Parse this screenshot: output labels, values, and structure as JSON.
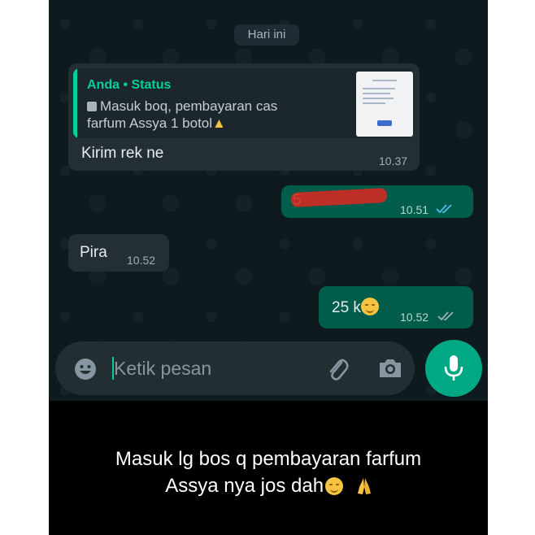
{
  "chat": {
    "date_chip": "Hari ini",
    "messages": [
      {
        "id": "m1",
        "direction": "incoming",
        "quote_author": "Anda • Status",
        "quote_line1": "Masuk boq,  pembayaran cas",
        "quote_line2": "farfum Assya 1 botol",
        "text": "Kirim rek ne",
        "time": "10.37"
      },
      {
        "id": "m2",
        "direction": "outgoing",
        "text": "5",
        "redacted": true,
        "time": "10.51",
        "status": "read"
      },
      {
        "id": "m3",
        "direction": "incoming",
        "text": "Pira",
        "time": "10.52"
      },
      {
        "id": "m4",
        "direction": "outgoing",
        "text": "25 k",
        "time": "10.52",
        "status": "read"
      }
    ]
  },
  "composer": {
    "placeholder": "Ketik pesan",
    "icons": [
      "emoji-icon",
      "attach-icon",
      "camera-icon",
      "mic-icon"
    ]
  },
  "caption": {
    "line1": "Masuk lg bos q pembayaran farfum",
    "line2": "Assya nya jos dah"
  },
  "colors": {
    "accent": "#06cf9c",
    "outgoing_bubble": "#005c4b",
    "incoming_bubble": "#242f35",
    "mic_button": "#00a884",
    "redaction": "#d22a22"
  }
}
